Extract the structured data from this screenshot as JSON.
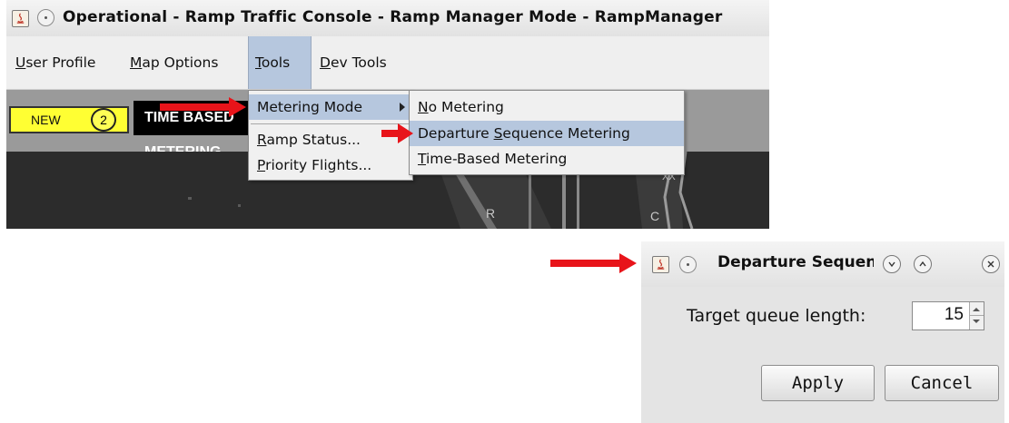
{
  "main_window": {
    "title": "Operational - Ramp Traffic Console - Ramp Manager Mode - RampManager"
  },
  "menubar": {
    "items": [
      {
        "label": "User Profile",
        "mnemonic_index": 0
      },
      {
        "label": "Map Options",
        "mnemonic_index": 0
      },
      {
        "label": "Tools",
        "mnemonic_index": 0
      },
      {
        "label": "Dev Tools",
        "mnemonic_index": 0
      }
    ],
    "active_item": "Tools"
  },
  "toolbar": {
    "new_label": "NEW",
    "new_count": "2",
    "mode_text": "TIME BASED METERING",
    "new_color": "#ffff33"
  },
  "map": {
    "labels": [
      "R",
      "C",
      "XX"
    ]
  },
  "tools_menu": {
    "items": [
      {
        "label": "Metering Mode",
        "has_submenu": true,
        "highlighted": true
      },
      {
        "label": "Ramp Status...",
        "mnemonic_index": 0
      },
      {
        "label": "Priority Flights...",
        "mnemonic_index": 0
      }
    ]
  },
  "metering_submenu": {
    "items": [
      {
        "label": "No Metering",
        "mnemonic_index": 0
      },
      {
        "label": "Departure Sequence Metering",
        "mnemonic_index": 10,
        "highlighted": true
      },
      {
        "label": "Time-Based Metering",
        "mnemonic_index": 0
      }
    ]
  },
  "dialog": {
    "title": "Departure Sequence Metering",
    "queue_label": "Target queue length:",
    "queue_value": "15",
    "apply_label": "Apply",
    "cancel_label": "Cancel"
  },
  "colors": {
    "highlight": "#b6c7de",
    "annotation_arrow": "#e8141a",
    "map_background": "#2c2c2c"
  }
}
